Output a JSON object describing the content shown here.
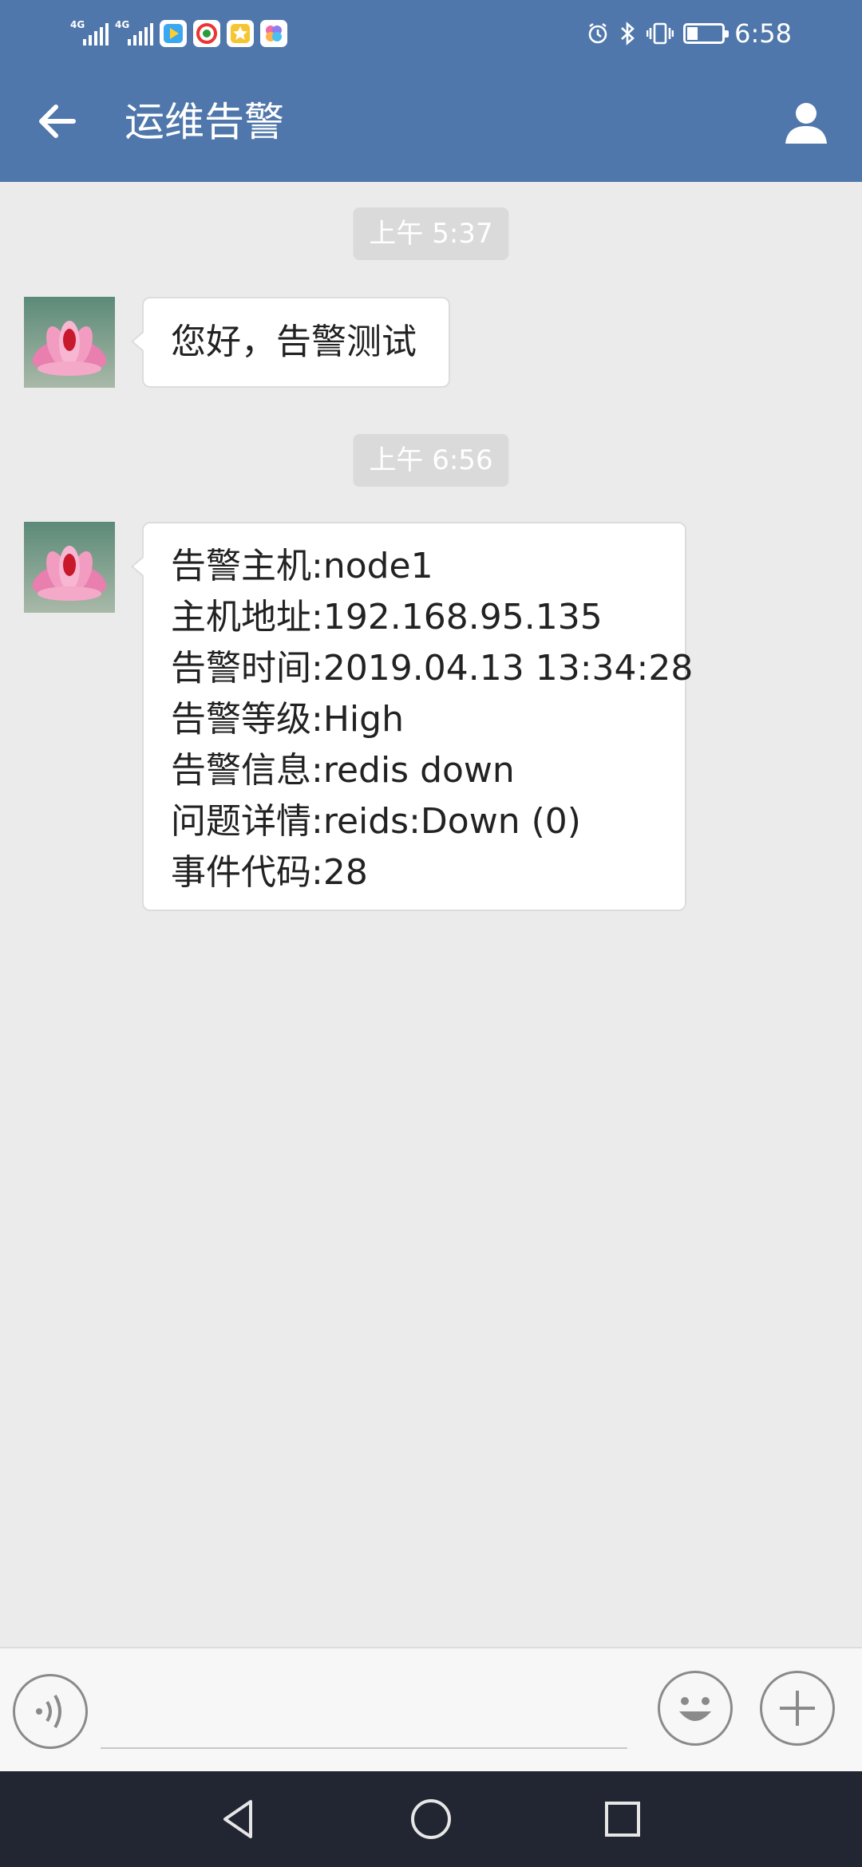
{
  "status_bar": {
    "signal_1_tag": "4G",
    "signal_2_tag": "4G",
    "time": "6:58",
    "battery_level": 0.28,
    "icons": [
      "signal-icon",
      "signal-icon",
      "video-app-icon",
      "browser-app-icon",
      "star-app-icon",
      "photos-app-icon",
      "alarm-icon",
      "bluetooth-icon",
      "vibrate-icon",
      "battery-icon"
    ]
  },
  "app_bar": {
    "title": "运维告警",
    "back_icon": "arrow-left-icon",
    "contact_icon": "person-icon"
  },
  "messages": [
    {
      "time": "上午 5:37",
      "lines": [
        "您好，告警测试"
      ]
    },
    {
      "time": "上午 6:56",
      "lines": [
        "告警主机:node1",
        "主机地址:192.168.95.135",
        "告警时间:2019.04.13 13:34:28",
        "告警等级:High",
        "告警信息:redis down",
        "问题详情:reids:Down (0)",
        "事件代码:28"
      ]
    }
  ],
  "input_bar": {
    "value": "",
    "voice_icon": "voice-icon",
    "emoji_icon": "emoji-icon",
    "plus_icon": "plus-icon"
  },
  "nav_bar": {
    "icons": [
      "nav-back-icon",
      "nav-home-icon",
      "nav-recents-icon"
    ]
  },
  "colors": {
    "header": "#4f77ab",
    "background": "#ebebeb",
    "bubble": "#ffffff",
    "timestamp_pill": "#dadada",
    "nav_bar": "#222632"
  }
}
